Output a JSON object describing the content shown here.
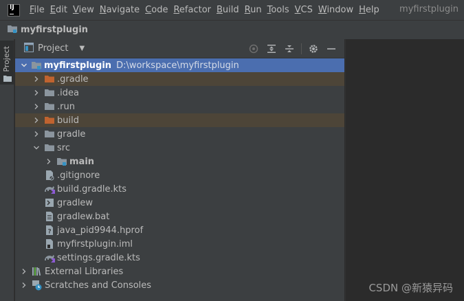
{
  "menubar": {
    "items": [
      {
        "letter": "F",
        "rest": "ile"
      },
      {
        "letter": "E",
        "rest": "dit"
      },
      {
        "letter": "V",
        "rest": "iew"
      },
      {
        "letter": "N",
        "rest": "avigate"
      },
      {
        "letter": "C",
        "rest": "ode"
      },
      {
        "letter": "R",
        "rest": "efactor"
      },
      {
        "letter": "B",
        "rest": "uild"
      },
      {
        "letter": "R",
        "rest": "un"
      },
      {
        "letter": "T",
        "rest": "ools"
      },
      {
        "letter": "V",
        "rest": "CS"
      },
      {
        "letter": "W",
        "rest": "indow"
      },
      {
        "letter": "H",
        "rest": "elp"
      }
    ],
    "project_title": "myfirstplugin"
  },
  "navbar": {
    "crumb": "myfirstplugin"
  },
  "side_tab": {
    "label": "Project"
  },
  "panel": {
    "title": "Project",
    "dropdown": "▼"
  },
  "tree": {
    "root": {
      "name": "myfirstplugin",
      "path": "D:\\workspace\\myfirstplugin"
    },
    "gradle": ".gradle",
    "idea": ".idea",
    "run": ".run",
    "build": "build",
    "gradle_dir": "gradle",
    "src": "src",
    "main": "main",
    "gitignore": ".gitignore",
    "build_gradle": "build.gradle.kts",
    "gradlew": "gradlew",
    "gradlew_bat": "gradlew.bat",
    "hprof": "java_pid9944.hprof",
    "iml": "myfirstplugin.iml",
    "settings_gradle": "settings.gradle.kts",
    "external_libraries": "External Libraries",
    "scratches": "Scratches and Consoles"
  },
  "watermark": "CSDN @新猿异码",
  "colors": {
    "selection": "#4b6eaf",
    "excluded_row": "#4d4538",
    "excluded_folder": "#c0632f",
    "folder": "#8b959e"
  }
}
